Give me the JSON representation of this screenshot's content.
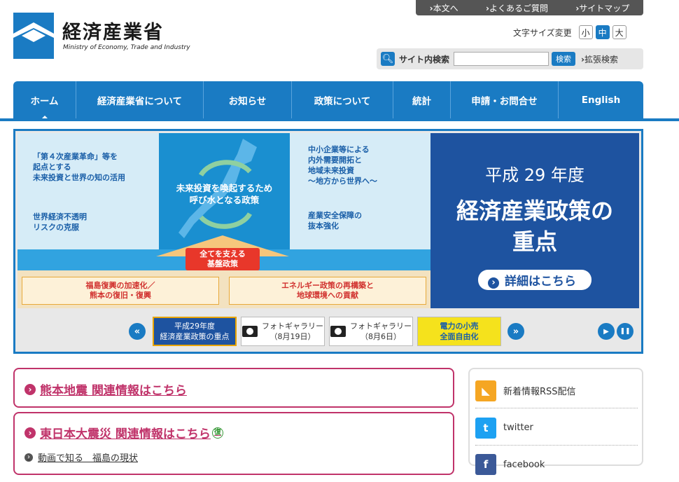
{
  "site": {
    "logo_ja": "経済産業省",
    "logo_en": "Ministry of Economy, Trade and Industry"
  },
  "toplinks": [
    "本文へ",
    "よくあるご質問",
    "サイトマップ"
  ],
  "font_size": {
    "label": "文字サイズ変更",
    "small": "小",
    "medium": "中",
    "large": "大",
    "selected": "中"
  },
  "search": {
    "label": "サイト内検索",
    "placeholder": "",
    "button": "検索",
    "advanced": "拡張検索"
  },
  "nav": [
    "ホーム",
    "経済産業省について",
    "お知らせ",
    "政策について",
    "統計",
    "申請・お問合せ",
    "English"
  ],
  "hero": {
    "panels": {
      "top_left": [
        "「第４次産業革命」等を",
        "起点とする",
        "未来投資と世界の知の活用"
      ],
      "mid_left": [
        "世界経済不透明",
        "リスクの克服"
      ],
      "map_caption": [
        "未来投資を喚起するため",
        "呼び水となる政策"
      ],
      "top_right": [
        "中小企業等による",
        "内外需要開拓と",
        "地域未来投資",
        "～地方から世界へ～"
      ],
      "mid_right": [
        "産業安全保障の",
        "抜本強化"
      ],
      "arrow": [
        "全てを支える",
        "基盤政策"
      ],
      "box_left": [
        "福島復興の加速化／",
        "熊本の復旧・復興"
      ],
      "box_right": [
        "エネルギー政策の再構築と",
        "地球環境への貢献"
      ]
    },
    "feature_year": "平成 29 年度",
    "feature_title_1": "経済産業政策の",
    "feature_title_2": "重点",
    "feature_button": "詳細はこちら"
  },
  "thumbs": [
    {
      "l1": "平成29年度",
      "l2": "経済産業政策の重点"
    },
    {
      "l1": "フォトギャラリー",
      "l2": "（8月19日）"
    },
    {
      "l1": "フォトギャラリー",
      "l2": "（8月6日）"
    },
    {
      "l1": "電力の小売",
      "l2": "全面自由化"
    }
  ],
  "controls": {
    "prev": "«",
    "next": "»",
    "play": "▶",
    "pause": "❚❚"
  },
  "notices": {
    "kumamoto": "熊本地震 関連情報はこちら",
    "tohoku": "東日本大震災 関連情報はこちら",
    "fukkou_mark": "復",
    "fukushima_video": "動画で知る　福島の現状"
  },
  "sidebar": [
    {
      "label": "新着情報RSS配信",
      "icon": "rss-icon",
      "color": "#f5a623"
    },
    {
      "label": "twitter",
      "icon": "twitter-icon",
      "color": "#1da1f2"
    },
    {
      "label": "facebook",
      "icon": "facebook-icon",
      "color": "#3b5998"
    }
  ],
  "colors": {
    "brand": "#1a7bc3",
    "feature": "#1e53a0",
    "alert": "#c0336a"
  }
}
